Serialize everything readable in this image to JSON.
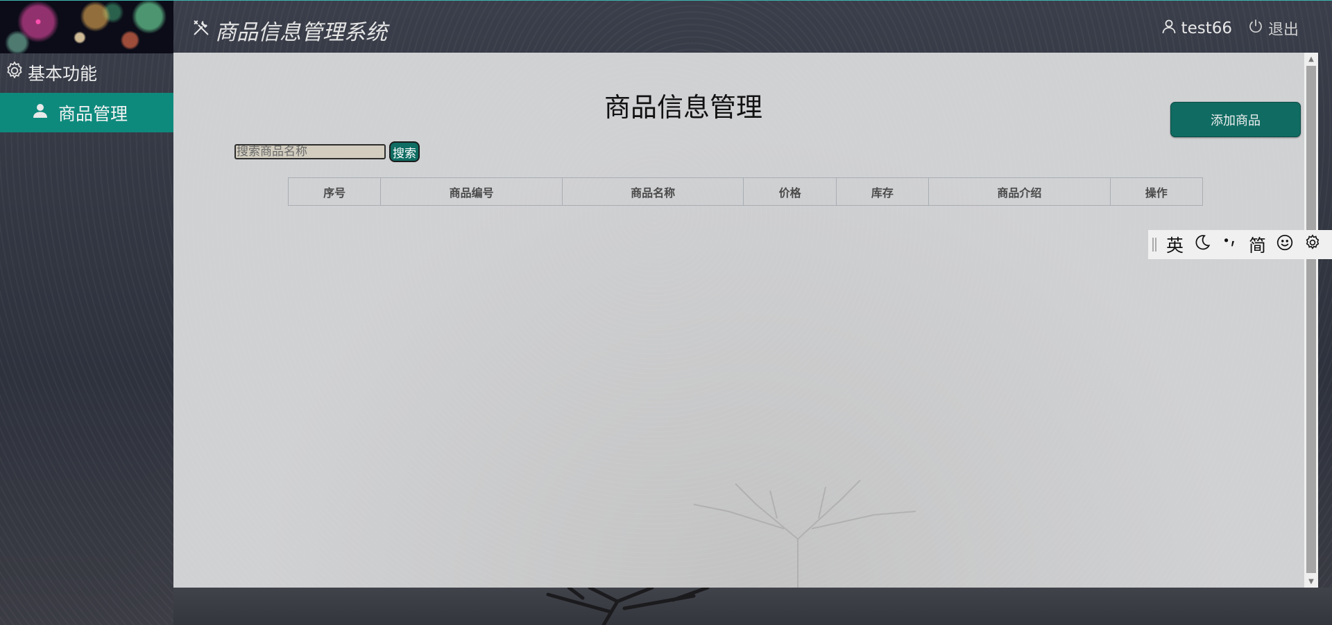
{
  "header": {
    "system_title": "商品信息管理系统",
    "username": "test66",
    "logout_label": "退出"
  },
  "sidebar": {
    "group_label": "基本功能",
    "items": [
      {
        "label": "商品管理"
      }
    ]
  },
  "main": {
    "page_title": "商品信息管理",
    "add_button_label": "添加商品",
    "search": {
      "placeholder": "搜索商品名称",
      "value": "",
      "button_label": "搜索"
    },
    "table": {
      "columns": [
        "序号",
        "商品编号",
        "商品名称",
        "价格",
        "库存",
        "商品介绍",
        "操作"
      ],
      "rows": []
    }
  },
  "ime_toolbar": {
    "lang_label": "英",
    "mode_label": "简"
  },
  "colors": {
    "accent": "#0e8a7d",
    "button": "#106b62",
    "sidebar_bg": "#2f333f",
    "panel_bg": "#d3d4d6"
  }
}
